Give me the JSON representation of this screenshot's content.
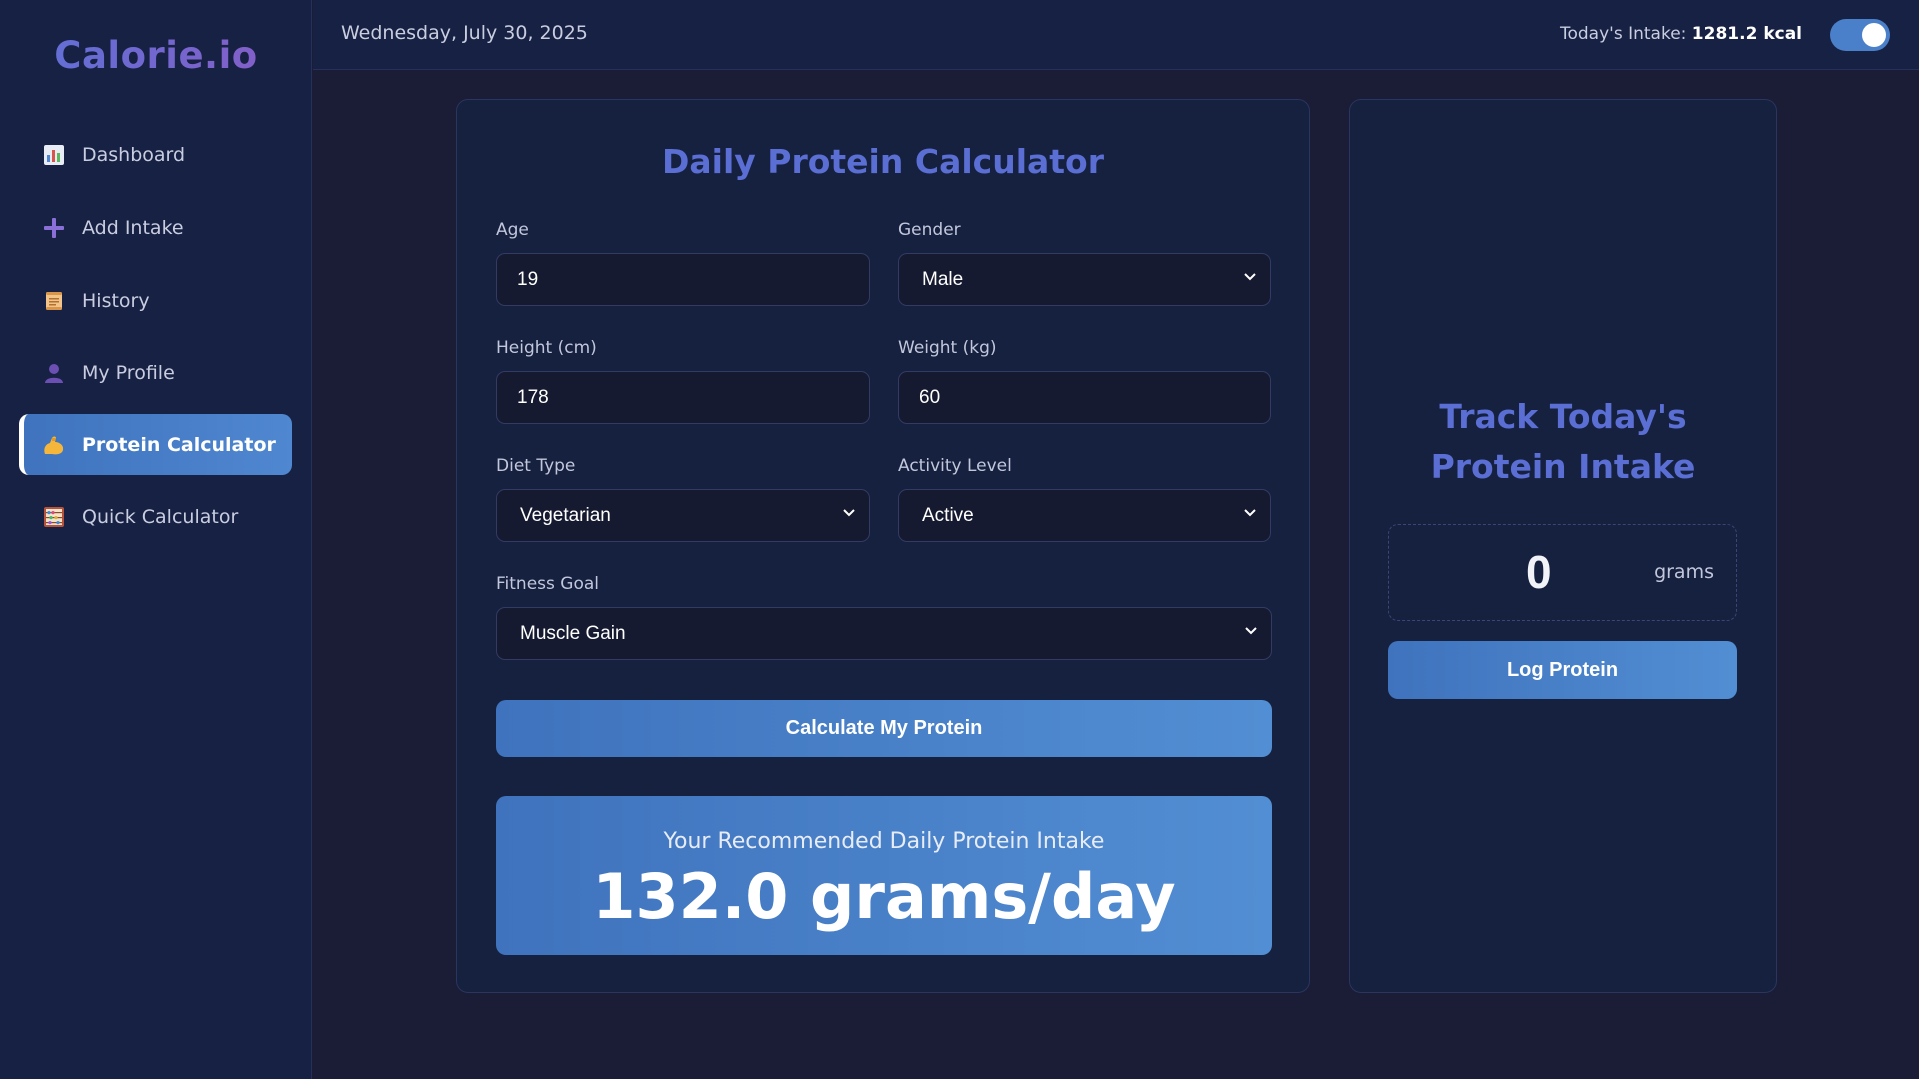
{
  "app": {
    "logo": "Calorie.io"
  },
  "sidebar": {
    "items": [
      {
        "label": "Dashboard",
        "icon": "bar-chart-icon"
      },
      {
        "label": "Add Intake",
        "icon": "plus-icon"
      },
      {
        "label": "History",
        "icon": "scroll-icon"
      },
      {
        "label": "My Profile",
        "icon": "user-icon"
      },
      {
        "label": "Protein Calculator",
        "icon": "flexed-biceps-icon",
        "active": true
      },
      {
        "label": "Quick Calculator",
        "icon": "abacus-icon"
      }
    ]
  },
  "header": {
    "date": "Wednesday, July 30, 2025",
    "intake_label": "Today's Intake:",
    "intake_value": "1281.2 kcal",
    "toggle_on": true
  },
  "calculator": {
    "title": "Daily Protein Calculator",
    "age": {
      "label": "Age",
      "value": "19"
    },
    "gender": {
      "label": "Gender",
      "value": "Male"
    },
    "height": {
      "label": "Height (cm)",
      "value": "178"
    },
    "weight": {
      "label": "Weight (kg)",
      "value": "60"
    },
    "diet": {
      "label": "Diet Type",
      "value": "Vegetarian"
    },
    "activity": {
      "label": "Activity Level",
      "value": "Active"
    },
    "goal": {
      "label": "Fitness Goal",
      "value": "Muscle Gain"
    },
    "button": "Calculate My Protein",
    "result_label": "Your Recommended Daily Protein Intake",
    "result_value": "132.0 grams/day"
  },
  "tracker": {
    "title_line1": "Track Today's",
    "title_line2": "Protein Intake",
    "value": "0",
    "unit": "grams",
    "button": "Log Protein"
  },
  "colors": {
    "background": "#1a1d35",
    "panel": "#15213f",
    "accent": "#4a7fc9",
    "title": "#5a6ed4"
  }
}
